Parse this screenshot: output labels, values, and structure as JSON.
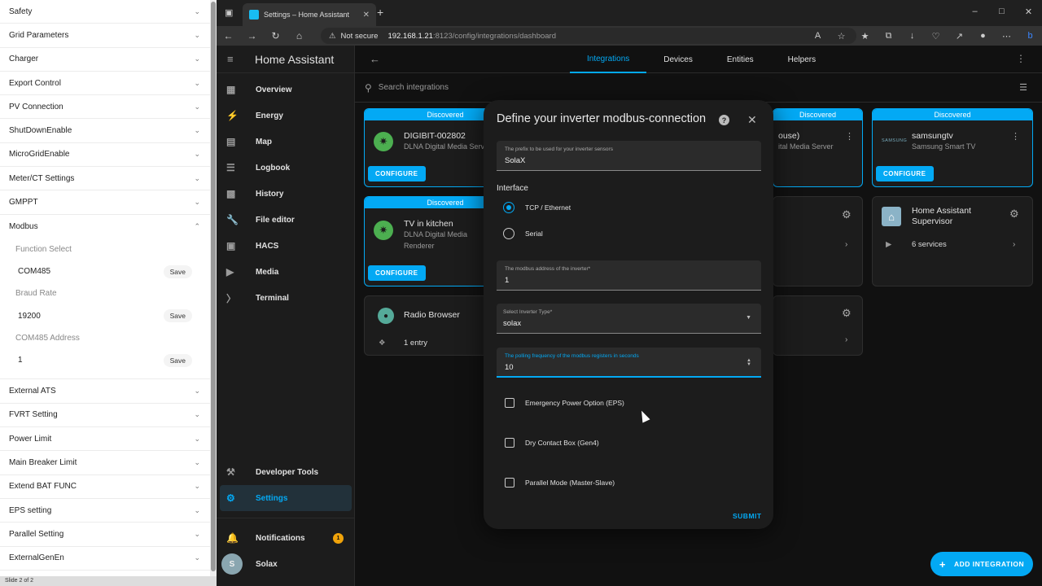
{
  "left_panel": {
    "items_top": [
      {
        "label": "Safety"
      },
      {
        "label": "Grid Parameters"
      },
      {
        "label": "Charger"
      },
      {
        "label": "Export Control"
      },
      {
        "label": "PV Connection"
      },
      {
        "label": "ShutDownEnable"
      },
      {
        "label": "MicroGridEnable"
      },
      {
        "label": "Meter/CT Settings"
      },
      {
        "label": "GMPPT"
      }
    ],
    "modbus": {
      "label": "Modbus",
      "function_select_label": "Function Select",
      "function_select_value": "COM485",
      "braud_rate_label": "Braud Rate",
      "braud_rate_value": "19200",
      "com485_address_label": "COM485 Address",
      "com485_address_value": "1",
      "save_label": "Save"
    },
    "items_bottom": [
      {
        "label": "External ATS"
      },
      {
        "label": "FVRT Setting"
      },
      {
        "label": "Power Limit"
      },
      {
        "label": "Main Breaker Limit"
      },
      {
        "label": "Extend BAT FUNC"
      },
      {
        "label": "EPS setting"
      },
      {
        "label": "Parallel Setting"
      },
      {
        "label": "ExternalGenEn"
      }
    ],
    "footer": "Slide 2 of 2"
  },
  "browser": {
    "tab_title": "Settings – Home Assistant",
    "not_secure": "Not secure",
    "url_host": "192.168.1.21",
    "url_path": ":8123/config/integrations/dashboard"
  },
  "ha": {
    "app_title": "Home Assistant",
    "sidebar": [
      {
        "label": "Overview",
        "icon": "view-dashboard-icon"
      },
      {
        "label": "Energy",
        "icon": "lightning-icon"
      },
      {
        "label": "Map",
        "icon": "map-icon"
      },
      {
        "label": "Logbook",
        "icon": "list-icon"
      },
      {
        "label": "History",
        "icon": "chart-icon"
      },
      {
        "label": "File editor",
        "icon": "wrench-icon"
      },
      {
        "label": "HACS",
        "icon": "hacs-icon"
      },
      {
        "label": "Media",
        "icon": "play-icon"
      },
      {
        "label": "Terminal",
        "icon": "console-icon"
      }
    ],
    "sidebar_bottom": {
      "developer_tools": "Developer Tools",
      "settings": "Settings",
      "notifications": "Notifications",
      "notifications_count": "1",
      "user": "Solax",
      "user_initial": "S"
    },
    "tabs": [
      "Integrations",
      "Devices",
      "Entities",
      "Helpers"
    ],
    "search_placeholder": "Search integrations",
    "cards": {
      "discovered": "Discovered",
      "configure": "CONFIGURE",
      "digibit_name": "DIGIBIT-002802",
      "digibit_sub": "DLNA Digital Media Serv",
      "tv_name": "TV in kitchen",
      "tv_sub1": "DLNA Digital Media",
      "tv_sub2": "Renderer",
      "hidden_name": "ouse)",
      "hidden_sub": "ital Media Server",
      "samsung_name": "samsungtv",
      "samsung_sub": "Samsung Smart TV",
      "samsung_logo": "SAMSUNG",
      "radio_name": "Radio Browser",
      "radio_entries": "1 entry",
      "supervisor_name1": "Home Assistant",
      "supervisor_name2": "Supervisor",
      "supervisor_services": "6 services"
    },
    "add_integration": "ADD INTEGRATION"
  },
  "dialog": {
    "title": "Define your inverter modbus-connection",
    "prefix_label": "The prefix to be used for your inverter sensors",
    "prefix_value": "SolaX",
    "interface_label": "Interface",
    "interface_options": [
      "TCP / Ethernet",
      "Serial"
    ],
    "interface_selected": "TCP / Ethernet",
    "address_label": "The modbus address of the inverter*",
    "address_value": "1",
    "type_label": "Select Inverter Type*",
    "type_value": "solax",
    "polling_label": "The polling frequency of the modbus registers in seconds",
    "polling_value": "10",
    "checkboxes": [
      {
        "label": "Emergency Power Option (EPS)",
        "checked": false
      },
      {
        "label": "Dry Contact Box (Gen4)",
        "checked": false
      },
      {
        "label": "Parallel Mode (Master-Slave)",
        "checked": false
      }
    ],
    "submit": "SUBMIT"
  }
}
